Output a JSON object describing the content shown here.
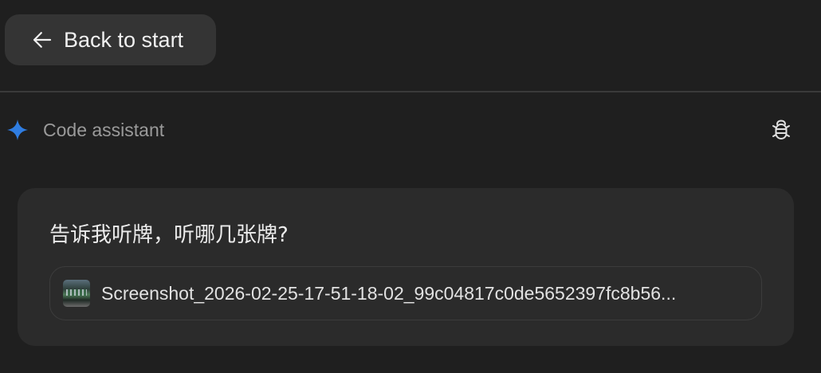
{
  "header": {
    "back_label": "Back to start"
  },
  "assistant": {
    "title": "Code assistant",
    "icon": "sparkle-icon",
    "accent_color": "#2f7de1"
  },
  "message": {
    "text": "告诉我听牌，听哪几张牌?",
    "attachment": {
      "file_name": "Screenshot_2026-02-25-17-51-18-02_99c04817c0de5652397fc8b56..."
    }
  }
}
